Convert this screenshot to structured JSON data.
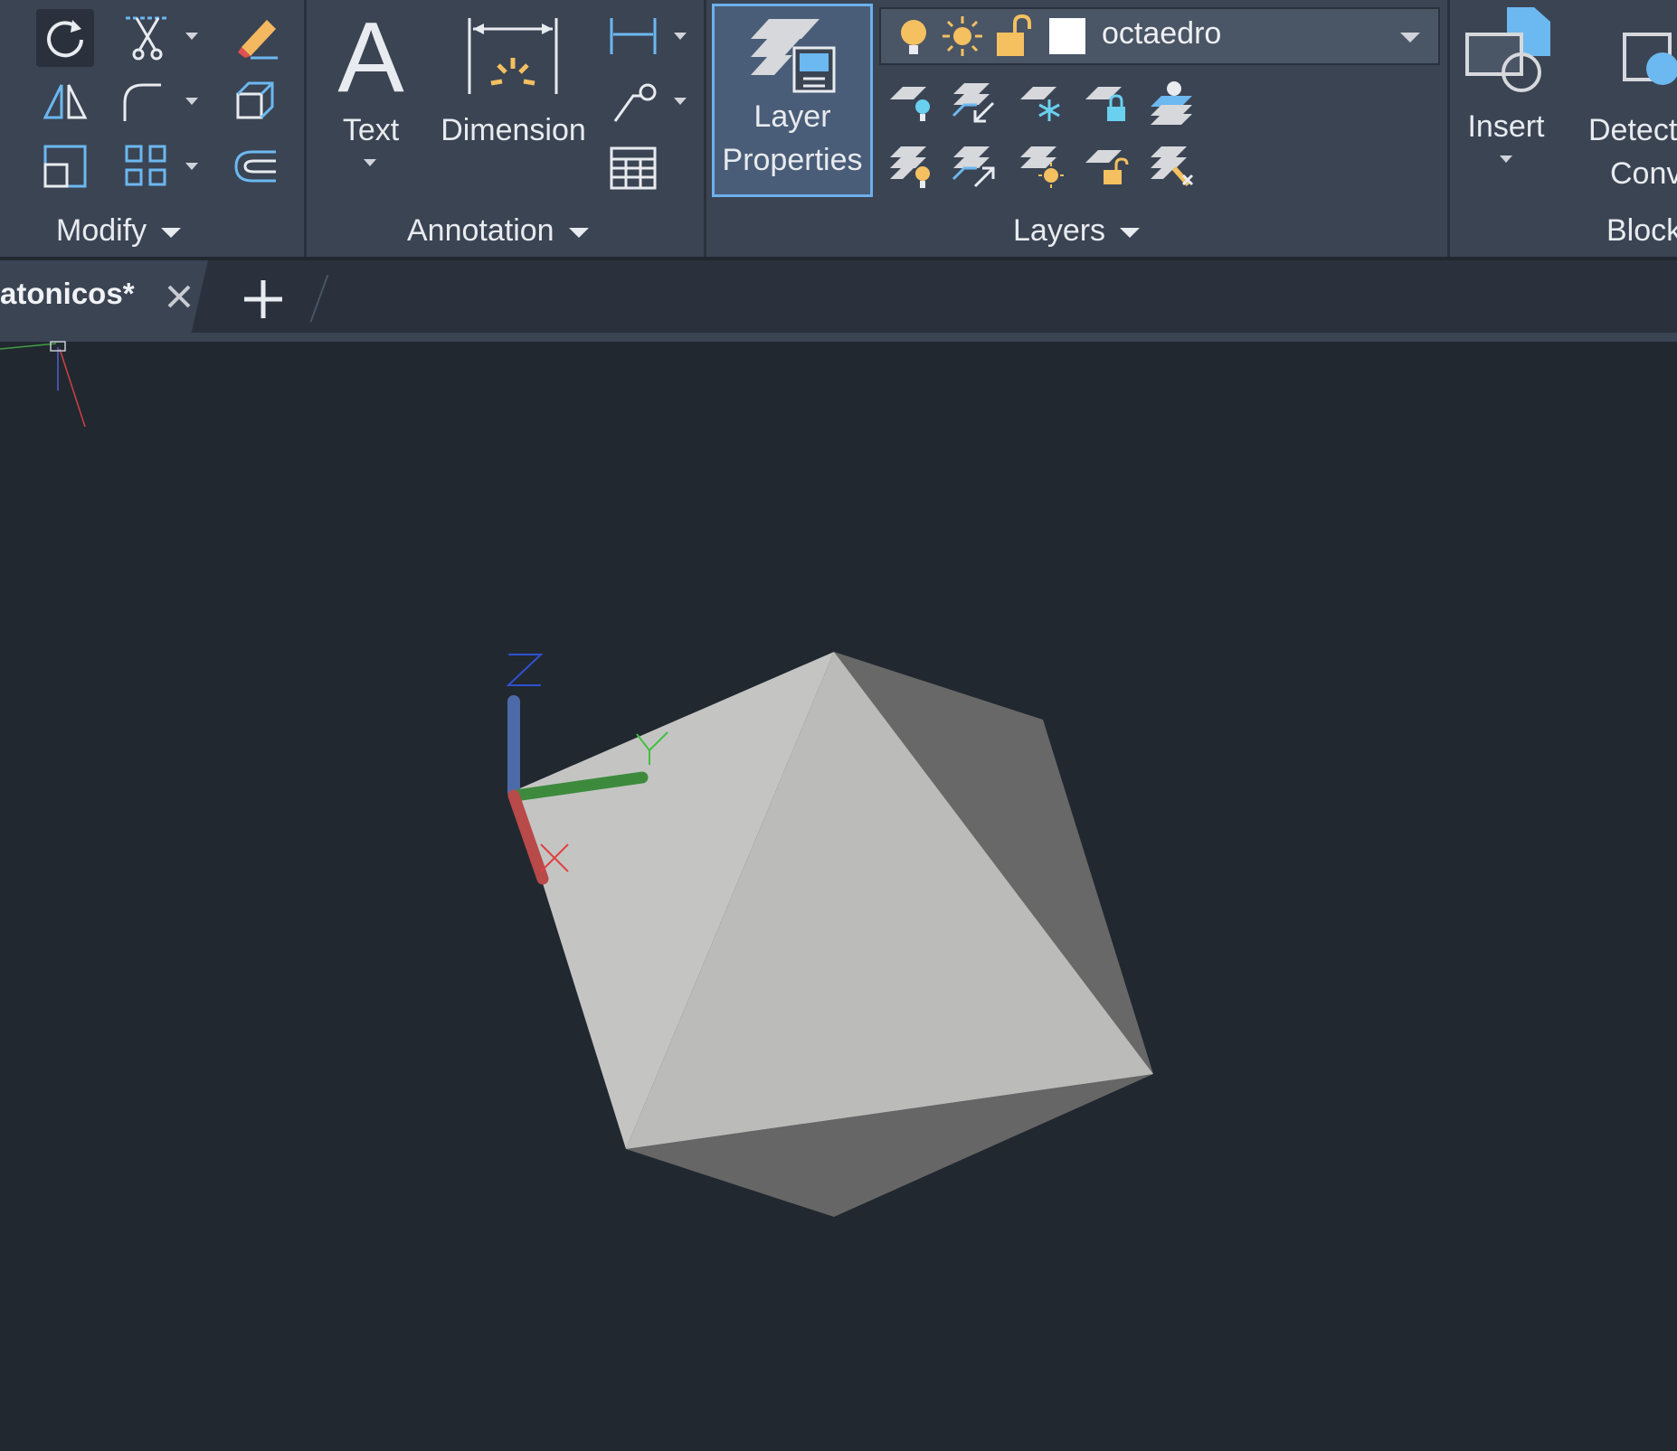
{
  "ribbon": {
    "panels": {
      "modify": {
        "label": "Modify"
      },
      "annotation": {
        "label": "Annotation",
        "text_label": "Text",
        "dimension_label": "Dimension"
      },
      "layers": {
        "label": "Layers",
        "layer_properties_label_1": "Layer",
        "layer_properties_label_2": "Properties",
        "current_layer": "octaedro"
      },
      "block": {
        "label": "Block",
        "insert_label": "Insert",
        "detect_label_1": "Detect",
        "detect_label_2": "Conv"
      }
    }
  },
  "tabs": {
    "active_tab": "atonicos*"
  },
  "viewport": {
    "ucs": {
      "x_label": "X",
      "y_label": "Y",
      "z_label": "Z"
    },
    "colors": {
      "background": "#212830",
      "face_light": "#c4c5c3",
      "face_mid": "#bbbcba",
      "face_dark": "#686868"
    }
  }
}
